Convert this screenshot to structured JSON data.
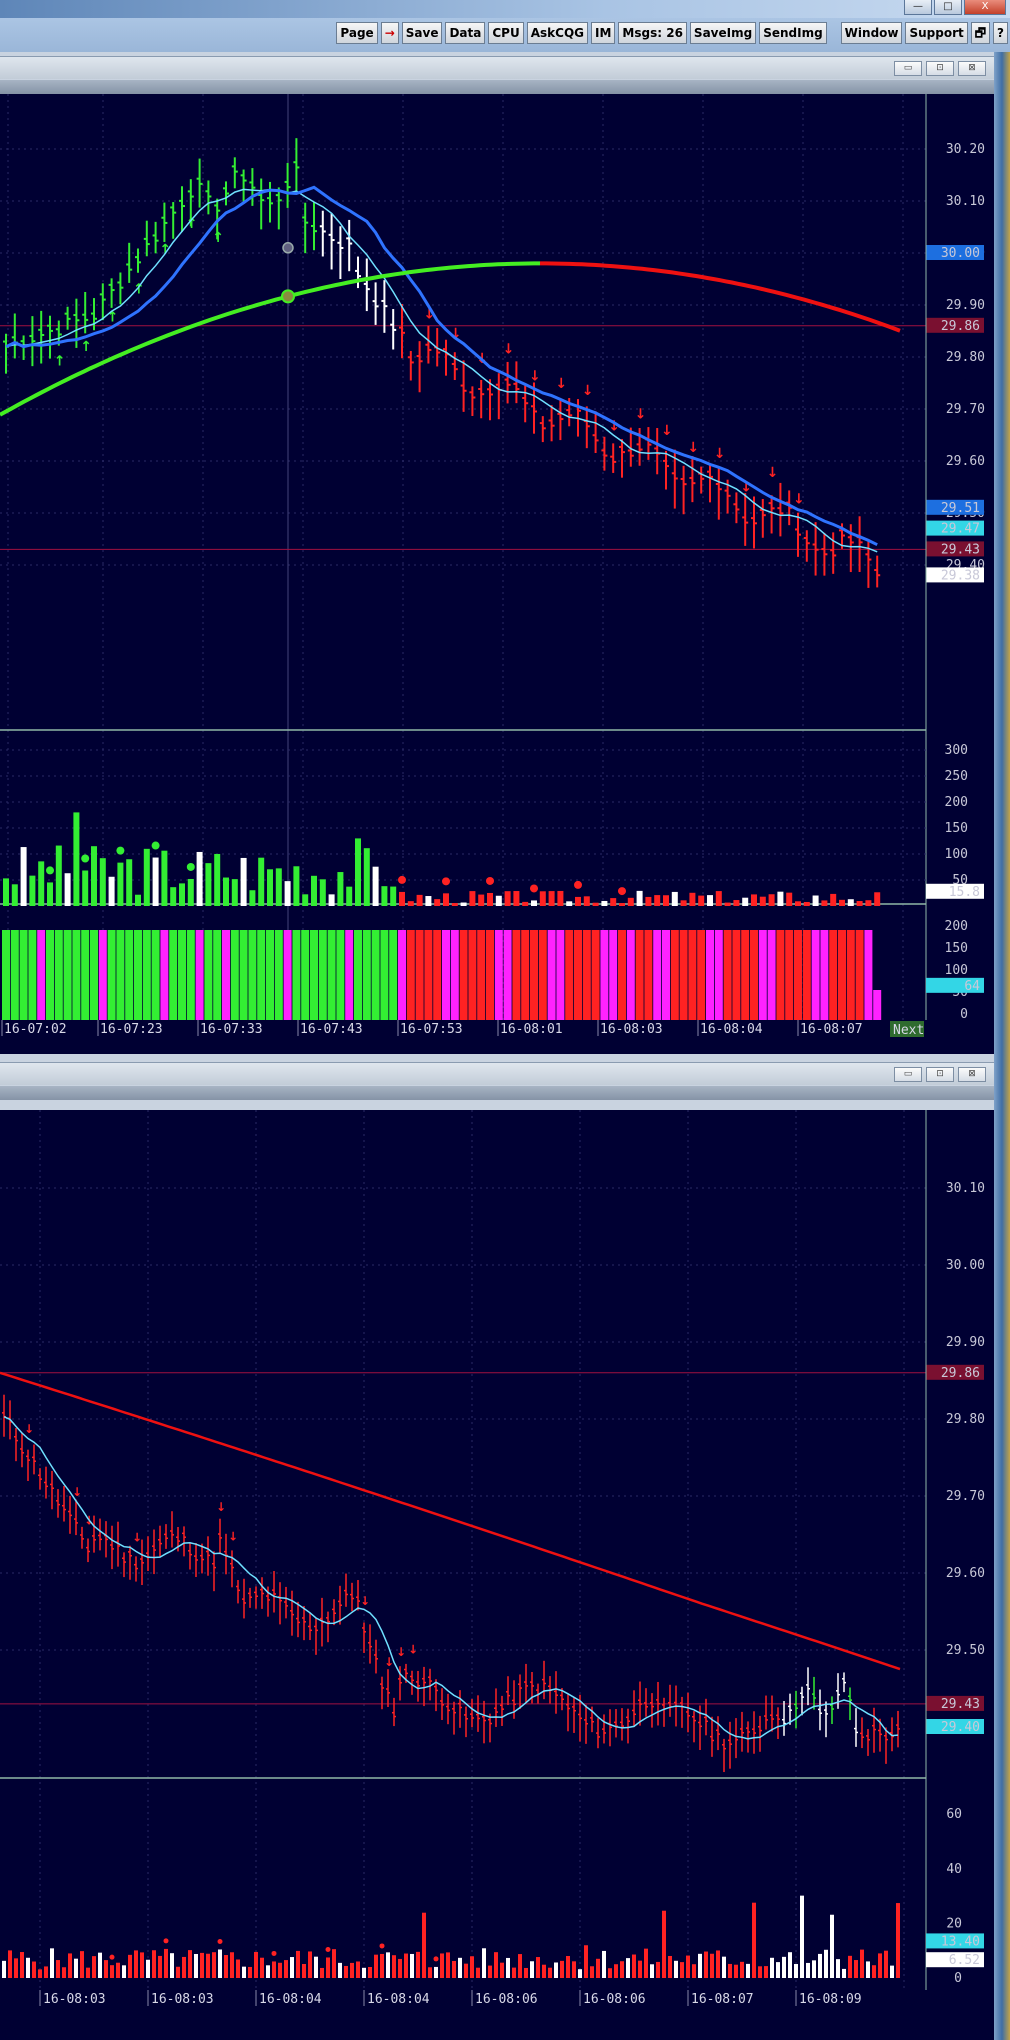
{
  "toolbar": {
    "buttons": [
      {
        "id": "page",
        "label": "Page"
      },
      {
        "id": "arrow",
        "label": "→"
      },
      {
        "id": "save",
        "label": "Save"
      },
      {
        "id": "data",
        "label": "Data"
      },
      {
        "id": "cpu",
        "label": "CPU"
      },
      {
        "id": "askcqg",
        "label": "AskCQG"
      },
      {
        "id": "im",
        "label": "IM"
      },
      {
        "id": "msgs",
        "label": "Msgs: 26"
      },
      {
        "id": "saveimg",
        "label": "SaveImg"
      },
      {
        "id": "sendimg",
        "label": "SendImg"
      },
      {
        "id": "window",
        "label": "Window"
      },
      {
        "id": "support",
        "label": "Support"
      },
      {
        "id": "restore",
        "label": "🗗"
      },
      {
        "id": "help",
        "label": "?"
      }
    ],
    "window_controls": [
      "—",
      "□",
      "X"
    ]
  },
  "pane_controls": [
    "▭",
    "⊡",
    "⊠"
  ],
  "colors": {
    "background": "#000033",
    "up": "#33ee33",
    "down": "#ff2222",
    "neutral": "#ffffff",
    "magenta": "#ff22ff",
    "fast_ma": "#2f73ff",
    "slow_ma": "#6fe0ff",
    "long_ma_up": "#44ee22",
    "long_ma_down": "#ee1111"
  },
  "top_chart": {
    "price_axis": [
      "30.20",
      "30.10",
      "30.00",
      "29.90",
      "29.80",
      "29.70",
      "29.60",
      "29.50",
      "29.40"
    ],
    "price_tags": [
      {
        "label": "30.00",
        "value": 30.0,
        "style": "blue"
      },
      {
        "label": "29.86",
        "value": 29.86,
        "style": "maroon"
      },
      {
        "label": "29.51",
        "value": 29.51,
        "style": "blue"
      },
      {
        "label": "29.47",
        "value": 29.47,
        "style": "cyan"
      },
      {
        "label": "29.43",
        "value": 29.43,
        "style": "maroon"
      },
      {
        "label": "29.38",
        "value": 29.38,
        "style": "white"
      }
    ],
    "volume_axis": [
      "300",
      "250",
      "200",
      "150",
      "100",
      "50"
    ],
    "volume_tag": "15.8",
    "hist_axis": [
      "200",
      "150",
      "100",
      "50",
      "0"
    ],
    "hist_tag": "64",
    "time_labels": [
      "16-07:02",
      "16-07:23",
      "16-07:33",
      "16-07:43",
      "16-07:53",
      "16-08:01",
      "16-08:03",
      "16-08:04",
      "16-08:07"
    ],
    "next_label": "Next"
  },
  "bottom_chart": {
    "price_axis": [
      "30.10",
      "30.00",
      "29.90",
      "29.80",
      "29.70",
      "29.60",
      "29.50"
    ],
    "price_tags": [
      {
        "label": "29.86",
        "value": 29.86,
        "style": "maroon"
      },
      {
        "label": "29.43",
        "value": 29.43,
        "style": "maroon"
      },
      {
        "label": "29.40",
        "value": 29.4,
        "style": "cyan"
      }
    ],
    "volume_axis": [
      "60",
      "40",
      "20",
      "0"
    ],
    "volume_tags": [
      "13.40",
      "6.52"
    ],
    "time_labels": [
      "16-08:03",
      "16-08:03",
      "16-08:04",
      "16-08:04",
      "16-08:06",
      "16-08:06",
      "16-08:07",
      "16-08:09"
    ]
  }
}
